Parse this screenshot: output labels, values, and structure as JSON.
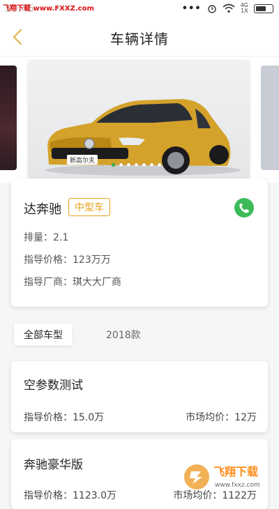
{
  "status_bar": {
    "time": "10:45",
    "watermark": "飞翔下载 www.FXXZ.com",
    "network": [
      "4G",
      "1X"
    ]
  },
  "header": {
    "title": "车辆详情"
  },
  "carousel": {
    "badge_text": "新高尔夫",
    "page_count": 7,
    "active_index": 0
  },
  "vehicle": {
    "name": "达奔驰",
    "type_tag": "中型车",
    "displacement_label": "排量：",
    "displacement_value": "2.1",
    "guide_price_label": "指导价格：",
    "guide_price_value": "123万万",
    "manufacturer_label": "指导厂商：",
    "manufacturer_value": "琪大大厂商"
  },
  "filters": {
    "all_label": "全部车型",
    "year_label": "2018款"
  },
  "models": [
    {
      "name": "空参数测试",
      "guide_price": "指导价格：15.0万",
      "market_price": "市场均价：12万"
    },
    {
      "name": "奔驰豪华版",
      "guide_price": "指导价格：1123.0万",
      "market_price": "市场均价：1122万"
    }
  ],
  "watermark_logo": {
    "brand": "飞翔下载",
    "url": "www.fxxz.com"
  },
  "colors": {
    "accent_gold": "#e5a21b",
    "phone_green": "#3dbb5a",
    "back_arrow": "#e0b34a"
  }
}
